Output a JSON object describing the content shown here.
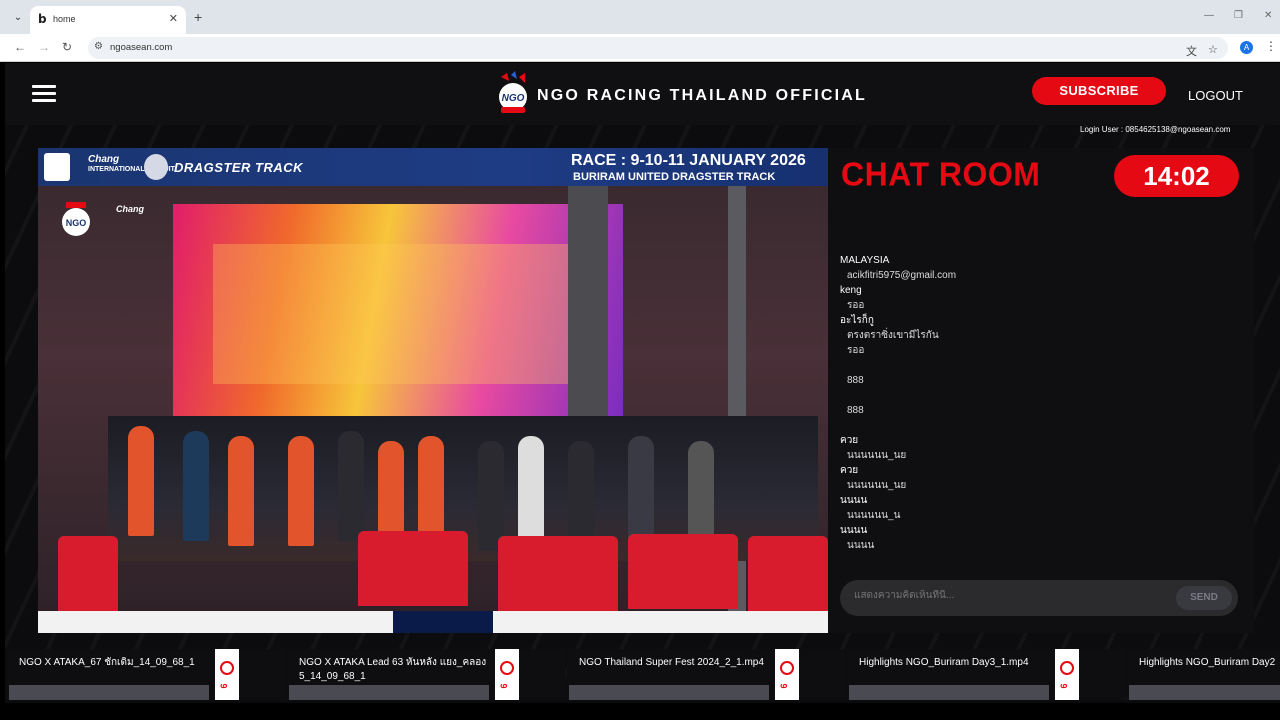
{
  "browser": {
    "tab_title": "home",
    "tab_favicon": "b",
    "new_tab_symbol": "+",
    "url": "ngoasean.com"
  },
  "header": {
    "site_title": "NGO RACING THAILAND OFFICIAL",
    "subscribe_label": "SUBSCRIBE",
    "logout_label": "LOGOUT",
    "login_user": "Login User : 0854625138@ngoasean.com"
  },
  "video": {
    "race_title": "RACE : 9-10-11 JANUARY 2026",
    "race_subtitle": "BURIRAM UNITED DRAGSTER TRACK",
    "banner_brand": "Chang",
    "banner_brand_sub": "INTERNATIONAL CIRCUIT",
    "banner_track": "DRAGSTER TRACK"
  },
  "chat": {
    "title": "CHAT ROOM",
    "timer": "14:02",
    "messages": [
      {
        "user": "MALAYSIA",
        "text": "acikfitri5975@gmail.com"
      },
      {
        "user": "keng",
        "text": "รออ"
      },
      {
        "user": "อะไรก็กู",
        "text": "ตรงตราซิ่งเขามีไรกัน"
      },
      {
        "user": "",
        "text": "รออ"
      },
      {
        "user": "",
        "text": ""
      },
      {
        "user": "",
        "text": "888"
      },
      {
        "user": "",
        "text": ""
      },
      {
        "user": "",
        "text": "888"
      },
      {
        "user": "",
        "text": ""
      },
      {
        "user": "ควย",
        "text": "นนนนนน_นย"
      },
      {
        "user": "ควย",
        "text": "นนนนนน_นย"
      },
      {
        "user": "นนนน",
        "text": "นนนนนน_น"
      },
      {
        "user": "นนนน",
        "text": "นนนน"
      }
    ],
    "input_placeholder": "แสดงความคิดเห็นที่นี่...",
    "send_label": "SEND"
  },
  "videos_strip": [
    {
      "title": "NGO X ATAKA_67 ชักเดิม_14_09_68_1",
      "side_num": "9"
    },
    {
      "title": "NGO X ATAKA Lead 63 หันหลัง แยง_คลอง 5_14_09_68_1",
      "side_num": "9"
    },
    {
      "title": "NGO Thailand Super Fest 2024_2_1.mp4",
      "side_num": "9"
    },
    {
      "title": "Highlights NGO_Buriram Day3_1.mp4",
      "side_num": "9"
    },
    {
      "title": "Highlights NGO_Buriram Day2",
      "side_num": ""
    }
  ],
  "colors": {
    "accent": "#e50914",
    "header_bg": "#101012",
    "banner_blue": "#1e3c84"
  }
}
